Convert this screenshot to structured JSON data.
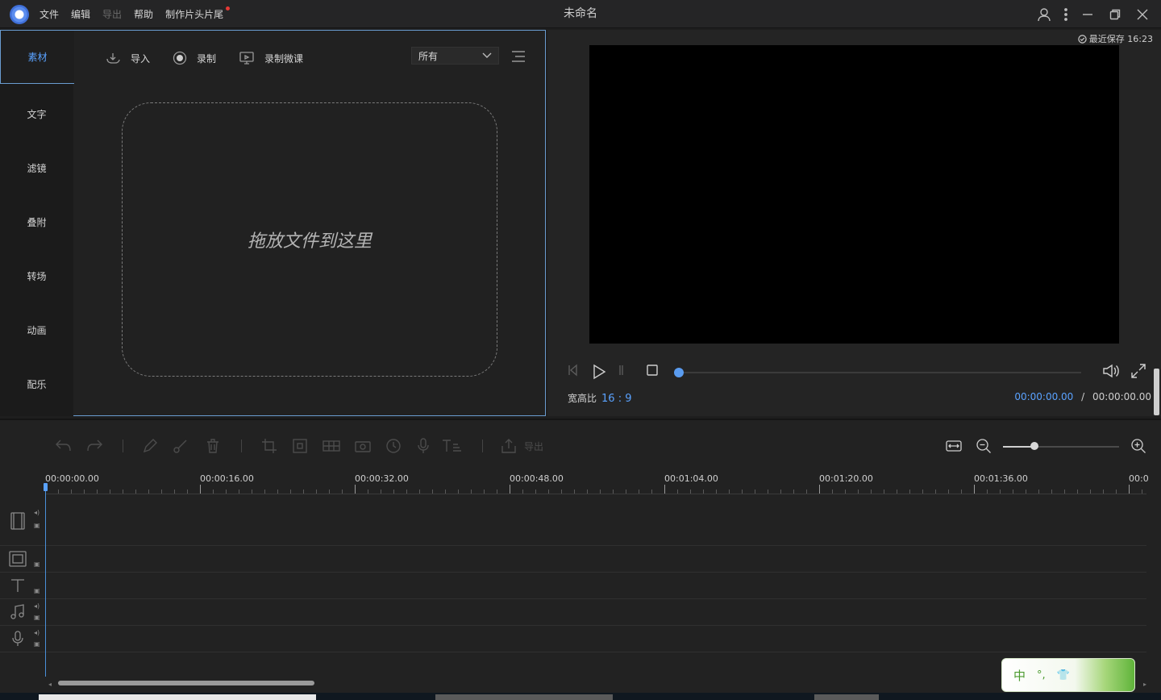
{
  "app": {
    "window_title": "未命名",
    "menu": [
      "文件",
      "编辑",
      "导出",
      "帮助",
      "制作片头片尾"
    ]
  },
  "sidebar": {
    "tabs": [
      "素材",
      "文字",
      "滤镜",
      "叠附",
      "转场",
      "动画",
      "配乐"
    ],
    "active_index": 0
  },
  "media": {
    "import_label": "导入",
    "record_label": "录制",
    "record_lecture_label": "录制微课",
    "filter_value": "所有",
    "drop_hint": "拖放文件到这里"
  },
  "preview": {
    "save_status": "最近保存 16:23",
    "aspect_label": "宽高比",
    "aspect_value": "16 : 9",
    "current_time": "00:00:00.00",
    "time_separator": "/",
    "total_time": "00:00:00.00",
    "progress_fraction": 0
  },
  "timeline": {
    "export_label": "导出",
    "ruler_labels": [
      "00:00:00.00",
      "00:00:16.00",
      "00:00:32.00",
      "00:00:48.00",
      "00:01:04.00",
      "00:01:20.00",
      "00:01:36.00",
      "00:0"
    ],
    "zoom_fraction": 0.27
  },
  "ime": {
    "lang": "中",
    "punct": "°,"
  },
  "colors": {
    "accent": "#5aa2ff",
    "panel_border": "#6a9cd0",
    "background": "#1e1e1e"
  }
}
